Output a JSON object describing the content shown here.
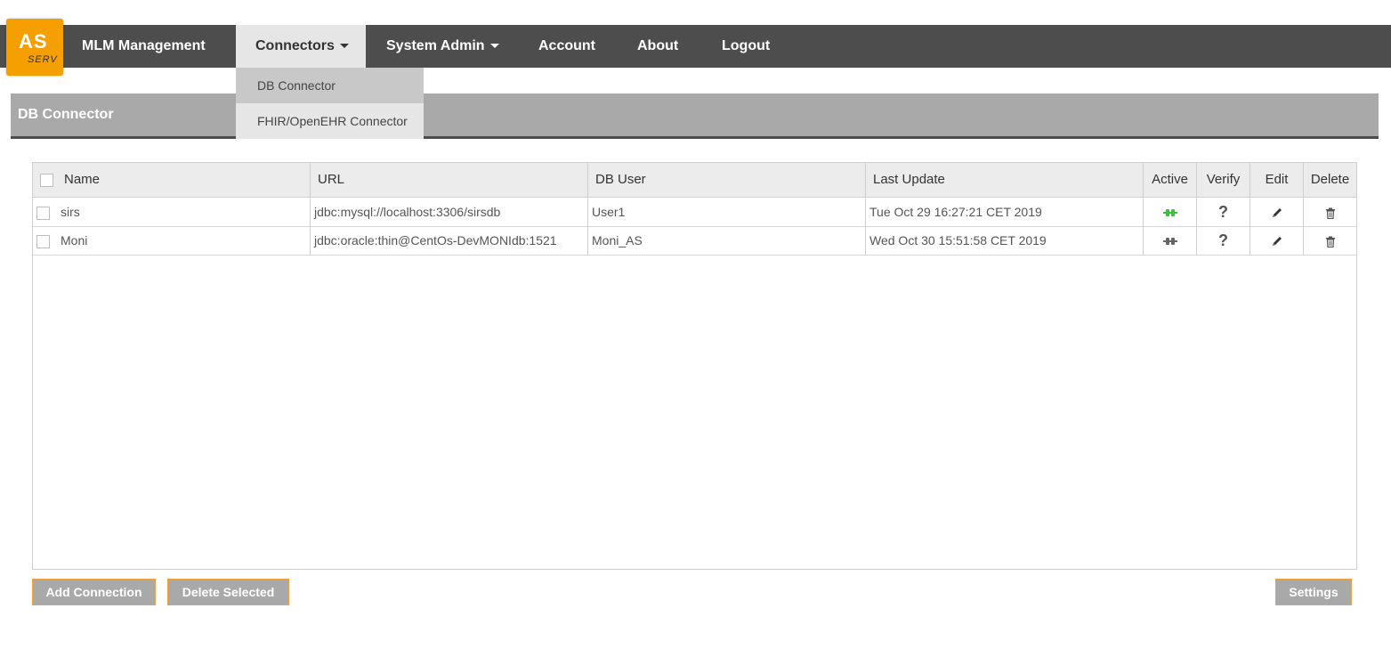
{
  "brand": {
    "logo_main": "AS",
    "logo_sub": "SERV",
    "accent_color": "#f5a000"
  },
  "nav": {
    "items": [
      {
        "label": "MLM Management",
        "dropdown": false
      },
      {
        "label": "Connectors",
        "dropdown": true
      },
      {
        "label": "System Admin",
        "dropdown": true
      },
      {
        "label": "Account",
        "dropdown": false
      },
      {
        "label": "About",
        "dropdown": false
      },
      {
        "label": "Logout",
        "dropdown": false
      }
    ],
    "connectors_menu": [
      {
        "label": "DB Connector",
        "active": true
      },
      {
        "label": "FHIR/OpenEHR Connector",
        "active": false
      }
    ]
  },
  "page": {
    "title": "DB Connector"
  },
  "table": {
    "columns": [
      "Name",
      "URL",
      "DB User",
      "Last Update",
      "Active",
      "Verify",
      "Edit",
      "Delete"
    ],
    "rows": [
      {
        "name": "sirs",
        "url": "jdbc:mysql://localhost:3306/sirsdb",
        "db_user": "User1",
        "last_update": "Tue Oct 29 16:27:21 CET 2019",
        "active": true,
        "active_icon": "plug-connected-icon",
        "verify_label": "?"
      },
      {
        "name": "Moni",
        "url": "jdbc:oracle:thin@CentOs-DevMONIdb:1521",
        "db_user": "Moni_AS",
        "last_update": "Wed Oct 30 15:51:58 CET 2019",
        "active": false,
        "active_icon": "plug-disconnected-icon",
        "verify_label": "?"
      }
    ]
  },
  "buttons": {
    "add_connection": "Add Connection",
    "delete_selected": "Delete Selected",
    "settings": "Settings"
  },
  "colors": {
    "nav_bg": "#4d4d4d",
    "header_bg": "#a9a9a9",
    "active_green": "#3cbf3c",
    "inactive_gray": "#666666"
  }
}
